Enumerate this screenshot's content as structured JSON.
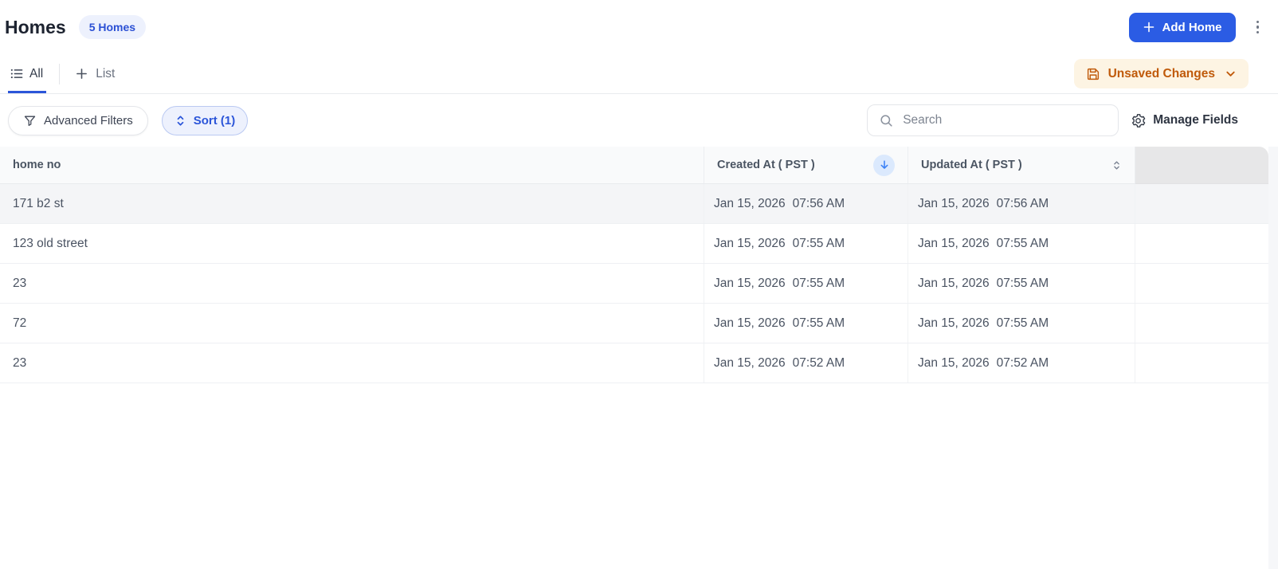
{
  "header": {
    "title": "Homes",
    "count_badge": "5 Homes",
    "add_button": "Add Home"
  },
  "tabs": {
    "all": "All",
    "new_list": "List"
  },
  "status": {
    "unsaved_label": "Unsaved Changes"
  },
  "toolbar": {
    "advanced_filters": "Advanced Filters",
    "sort": "Sort (1)",
    "search_placeholder": "Search",
    "manage_fields": "Manage Fields"
  },
  "table": {
    "columns": [
      "home no",
      "Created At ( PST )",
      "Updated At ( PST )"
    ],
    "sorted_column": "Created At ( PST )",
    "sort_direction": "desc",
    "highlighted_row_index": 0,
    "rows": [
      {
        "home_no": "171 b2 st",
        "created": {
          "date": "Jan 15, 2026",
          "time": "07:56 AM"
        },
        "updated": {
          "date": "Jan 15, 2026",
          "time": "07:56 AM"
        }
      },
      {
        "home_no": "123 old street",
        "created": {
          "date": "Jan 15, 2026",
          "time": "07:55 AM"
        },
        "updated": {
          "date": "Jan 15, 2026",
          "time": "07:55 AM"
        }
      },
      {
        "home_no": "23",
        "created": {
          "date": "Jan 15, 2026",
          "time": "07:55 AM"
        },
        "updated": {
          "date": "Jan 15, 2026",
          "time": "07:55 AM"
        }
      },
      {
        "home_no": "72",
        "created": {
          "date": "Jan 15, 2026",
          "time": "07:55 AM"
        },
        "updated": {
          "date": "Jan 15, 2026",
          "time": "07:55 AM"
        }
      },
      {
        "home_no": "23",
        "created": {
          "date": "Jan 15, 2026",
          "time": "07:52 AM"
        },
        "updated": {
          "date": "Jan 15, 2026",
          "time": "07:52 AM"
        }
      }
    ]
  },
  "colors": {
    "primary_blue": "#2b5ce4",
    "link_blue": "#2b55d9",
    "badge_bg": "#edf1fd",
    "unsaved_text": "#c05a0a",
    "unsaved_bg": "#fdf4e3",
    "table_header_bg": "#f9fafb",
    "row_highlight": "#f4f5f7",
    "sorted_icon_blue": "#3c82f6",
    "sorted_icon_bg": "#dbe9fd"
  }
}
